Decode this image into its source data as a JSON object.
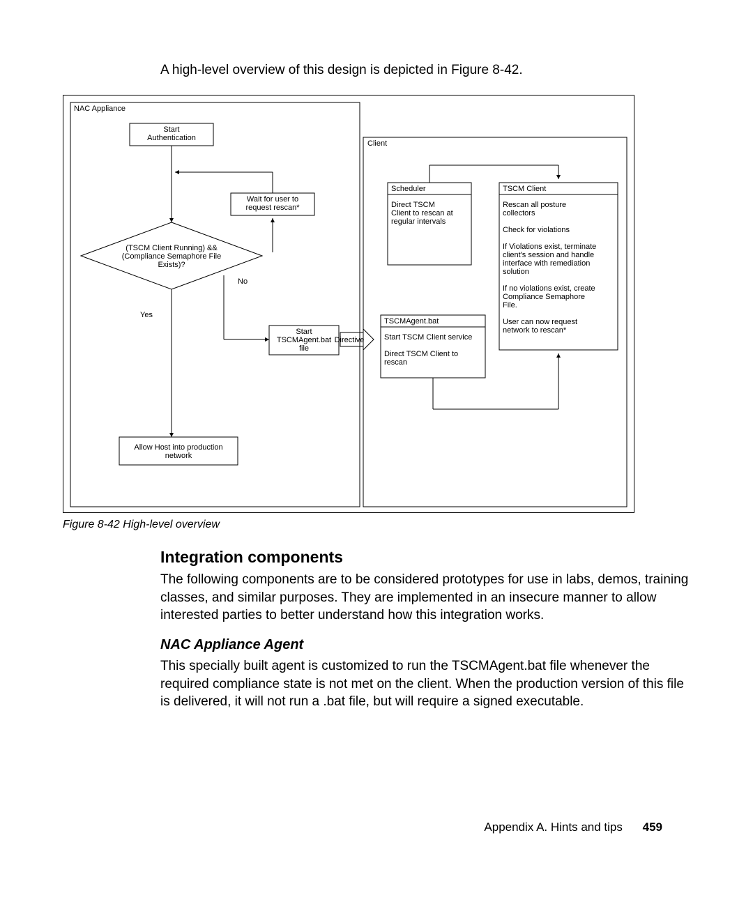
{
  "lead": "A high-level overview of this design is depicted in Figure 8-42.",
  "caption": "Figure 8-42   High-level overview",
  "section_title": "Integration components",
  "section_body": "The following components are to be considered prototypes for use in labs, demos, training classes, and similar purposes. They are implemented in an insecure manner to allow interested parties to better understand how this integration works.",
  "subhead": "NAC Appliance Agent",
  "subhead_body": "This specially built agent is customized to run the TSCMAgent.bat file whenever the required compliance state is not met on the client. When the production version of this file is delivered, it will not run a .bat file, but will require a signed executable.",
  "footer_text": "Appendix A. Hints and tips",
  "page_number": "459",
  "diagram": {
    "nac_label": "NAC Appliance",
    "start_auth_1": "Start",
    "start_auth_2": "Authentication",
    "wait_1": "Wait for user to",
    "wait_2": "request rescan*",
    "decision_1": "(TSCM Client Running) &&",
    "decision_2": "(Compliance Semaphore File",
    "decision_3": "Exists)?",
    "no_label": "No",
    "yes_label": "Yes",
    "start_bat_1": "Start",
    "start_bat_2": "TSCMAgent.bat",
    "start_bat_3": "file",
    "directive": "Directive",
    "allow_1": "Allow Host into production",
    "allow_2": "network",
    "client_label": "Client",
    "sched_title": "Scheduler",
    "sched_1": "Direct TSCM",
    "sched_2": "Client to rescan at",
    "sched_3": "regular intervals",
    "tscmagent_title": "TSCMAgent.bat",
    "tscmagent_1": "Start TSCM Client service",
    "tscmagent_2": "Direct TSCM Client to",
    "tscmagent_3": "rescan",
    "tscmclient_title": "TSCM Client",
    "tc_1": "Rescan all posture",
    "tc_2": "collectors",
    "tc_3": "Check for violations",
    "tc_4": "If Violations exist, terminate",
    "tc_5": "client's session and handle",
    "tc_6": "interface with remediation",
    "tc_7": "solution",
    "tc_8": "If no violations exist, create",
    "tc_9": "Compliance Semaphore",
    "tc_10": "File.",
    "tc_11": "User can now request",
    "tc_12": "network to rescan*"
  }
}
